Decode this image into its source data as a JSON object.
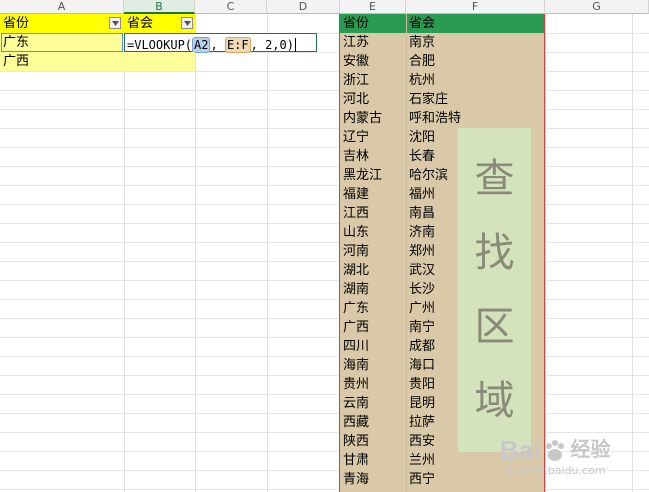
{
  "columns": [
    "A",
    "B",
    "C",
    "D",
    "E",
    "F",
    "G"
  ],
  "sheet": {
    "header_row": {
      "a": "省份",
      "b": "省会"
    },
    "rows": [
      {
        "a": "广东",
        "b_formula": {
          "prefix": "=VLOOKUP(",
          "ref1": "A2",
          "sep1": ", ",
          "ref2": "E:F",
          "tail": ", 2,0)"
        }
      },
      {
        "a": "广西"
      }
    ]
  },
  "lookup_table": {
    "header": {
      "e": "省份",
      "f": "省会"
    },
    "rows": [
      {
        "e": "江苏",
        "f": "南京"
      },
      {
        "e": "安徽",
        "f": "合肥"
      },
      {
        "e": "浙江",
        "f": "杭州"
      },
      {
        "e": "河北",
        "f": "石家庄"
      },
      {
        "e": "内蒙古",
        "f": "呼和浩特"
      },
      {
        "e": "辽宁",
        "f": "沈阳"
      },
      {
        "e": "吉林",
        "f": "长春"
      },
      {
        "e": "黑龙江",
        "f": "哈尔滨"
      },
      {
        "e": "福建",
        "f": "福州"
      },
      {
        "e": "江西",
        "f": "南昌"
      },
      {
        "e": "山东",
        "f": "济南"
      },
      {
        "e": "河南",
        "f": "郑州"
      },
      {
        "e": "湖北",
        "f": "武汉"
      },
      {
        "e": "湖南",
        "f": "长沙"
      },
      {
        "e": "广东",
        "f": "广州"
      },
      {
        "e": "广西",
        "f": "南宁"
      },
      {
        "e": "四川",
        "f": "成都"
      },
      {
        "e": "海南",
        "f": "海口"
      },
      {
        "e": "贵州",
        "f": "贵阳"
      },
      {
        "e": "云南",
        "f": "昆明"
      },
      {
        "e": "西藏",
        "f": "拉萨"
      },
      {
        "e": "陕西",
        "f": "西安"
      },
      {
        "e": "甘肃",
        "f": "兰州"
      },
      {
        "e": "青海",
        "f": "西宁"
      }
    ],
    "label_chars": [
      "查",
      "找",
      "区",
      "域"
    ]
  },
  "watermark": {
    "brand": "Bai",
    "brand_suffix": "经验",
    "url": "jingyan.baidu.com"
  },
  "colors": {
    "header_yellow": "#ffff00",
    "row_yellow": "#ffff99",
    "lookup_bg": "#d9c9a8",
    "lookup_header": "#2a9b52",
    "label_bg": "#d3e3bc",
    "border_red": "#d23d3d"
  }
}
